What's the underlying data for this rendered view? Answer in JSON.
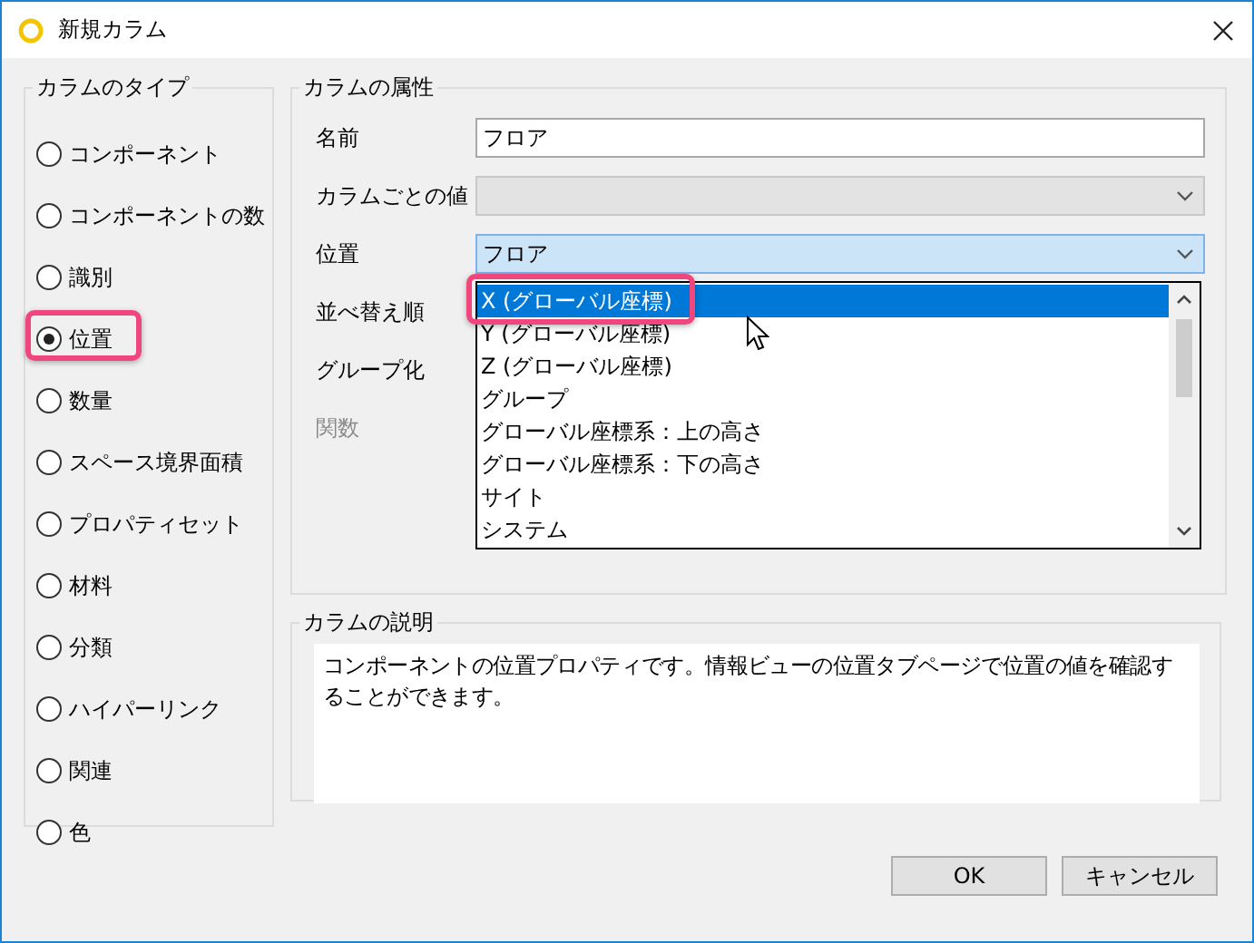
{
  "window": {
    "title": "新規カラム"
  },
  "column_type": {
    "title": "カラムのタイプ",
    "options": [
      {
        "label": "コンポーネント",
        "selected": false,
        "highlighted": false
      },
      {
        "label": "コンポーネントの数",
        "selected": false,
        "highlighted": false
      },
      {
        "label": "識別",
        "selected": false,
        "highlighted": false
      },
      {
        "label": "位置",
        "selected": true,
        "highlighted": true
      },
      {
        "label": "数量",
        "selected": false,
        "highlighted": false
      },
      {
        "label": "スペース境界面積",
        "selected": false,
        "highlighted": false
      },
      {
        "label": "プロパティセット",
        "selected": false,
        "highlighted": false
      },
      {
        "label": "材料",
        "selected": false,
        "highlighted": false
      },
      {
        "label": "分類",
        "selected": false,
        "highlighted": false
      },
      {
        "label": "ハイパーリンク",
        "selected": false,
        "highlighted": false
      },
      {
        "label": "関連",
        "selected": false,
        "highlighted": false
      },
      {
        "label": "色",
        "selected": false,
        "highlighted": false
      }
    ]
  },
  "attributes": {
    "title": "カラムの属性",
    "rows": [
      {
        "label": "名前",
        "kind": "text",
        "value": "フロア"
      },
      {
        "label": "カラムごとの値",
        "kind": "select",
        "disabled": true
      },
      {
        "label": "位置",
        "kind": "select",
        "value": "フロア",
        "focused": true
      },
      {
        "label": "並べ替え順",
        "kind": "covered"
      },
      {
        "label": "グループ化",
        "kind": "covered"
      },
      {
        "label": "関数",
        "kind": "covered",
        "disabled": true
      }
    ]
  },
  "dropdown_list": {
    "items": [
      {
        "label": "X (グローバル座標)",
        "selected": true,
        "highlighted": true
      },
      {
        "label": "Y (グローバル座標)",
        "selected": false,
        "highlighted": false
      },
      {
        "label": "Z (グローバル座標)",
        "selected": false,
        "highlighted": false
      },
      {
        "label": "グループ",
        "selected": false,
        "highlighted": false
      },
      {
        "label": "グローバル座標系：上の高さ",
        "selected": false,
        "highlighted": false
      },
      {
        "label": "グローバル座標系：下の高さ",
        "selected": false,
        "highlighted": false
      },
      {
        "label": "サイト",
        "selected": false,
        "highlighted": false
      },
      {
        "label": "システム",
        "selected": false,
        "highlighted": false
      }
    ]
  },
  "description": {
    "title": "カラムの説明",
    "text": "コンポーネントの位置プロパティです。情報ビューの位置タブページで位置の値を確認することができます。"
  },
  "buttons": [
    "OK",
    "キャンセル"
  ]
}
